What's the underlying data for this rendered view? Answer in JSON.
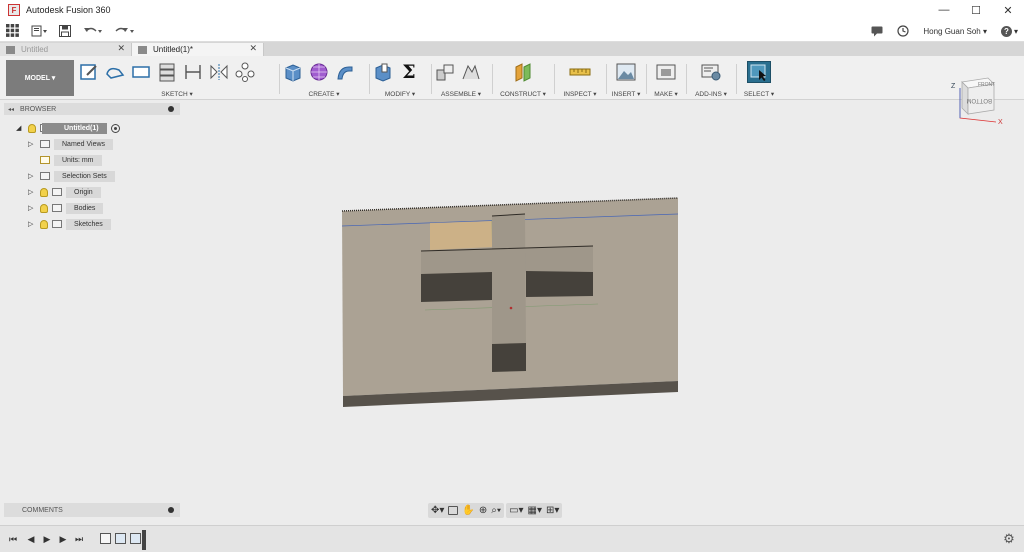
{
  "window": {
    "title": "Autodesk Fusion 360",
    "logo_letter": "F",
    "minimize": "—",
    "maximize": "☐",
    "close": "✕"
  },
  "qat": {
    "grid": "⋮⋮⋮",
    "file": "▤▾",
    "save": "🖫",
    "undo": "↶▾",
    "redo": "↷▾",
    "user": "Hong Guan Soh ▾",
    "help": "?▾"
  },
  "tabs": [
    {
      "label": "Untitled",
      "close": "✕",
      "active": false
    },
    {
      "label": "Untitled(1)*",
      "close": "✕",
      "active": true
    }
  ],
  "ribbon": {
    "workspace": "MODEL ▾",
    "groups": [
      {
        "label": "SKETCH ▾"
      },
      {
        "label": "CREATE ▾"
      },
      {
        "label": "MODIFY ▾"
      },
      {
        "label": "ASSEMBLE ▾"
      },
      {
        "label": "CONSTRUCT ▾"
      },
      {
        "label": "INSPECT ▾"
      },
      {
        "label": "INSERT ▾"
      },
      {
        "label": "MAKE ▾"
      },
      {
        "label": "ADD-INS ▾"
      },
      {
        "label": "SELECT ▾"
      }
    ],
    "sigma": "Σ"
  },
  "browser": {
    "title": "BROWSER",
    "collapse": "◂◂",
    "items": [
      {
        "label": "Untitled(1)"
      },
      {
        "label": "Named Views"
      },
      {
        "label": "Units: mm"
      },
      {
        "label": "Selection Sets"
      },
      {
        "label": "Origin"
      },
      {
        "label": "Bodies"
      },
      {
        "label": "Sketches"
      }
    ],
    "expand": "▷",
    "expanded": "◢"
  },
  "viewcube": {
    "front": "FRONT",
    "bottom": "BOTTOM",
    "z": "Z",
    "x": "X"
  },
  "comments": {
    "title": "COMMENTS"
  },
  "timeline": {
    "first": "⏮",
    "prev": "◀",
    "play": "▶",
    "next": "▶",
    "last": "⏭",
    "gear": "⚙"
  },
  "colors": {
    "plate_top": "#aba294",
    "plate_side": "#57524b",
    "cross_top": "#9f978a",
    "cross_side": "#45413b",
    "accent_select": "#2a6f8f"
  }
}
